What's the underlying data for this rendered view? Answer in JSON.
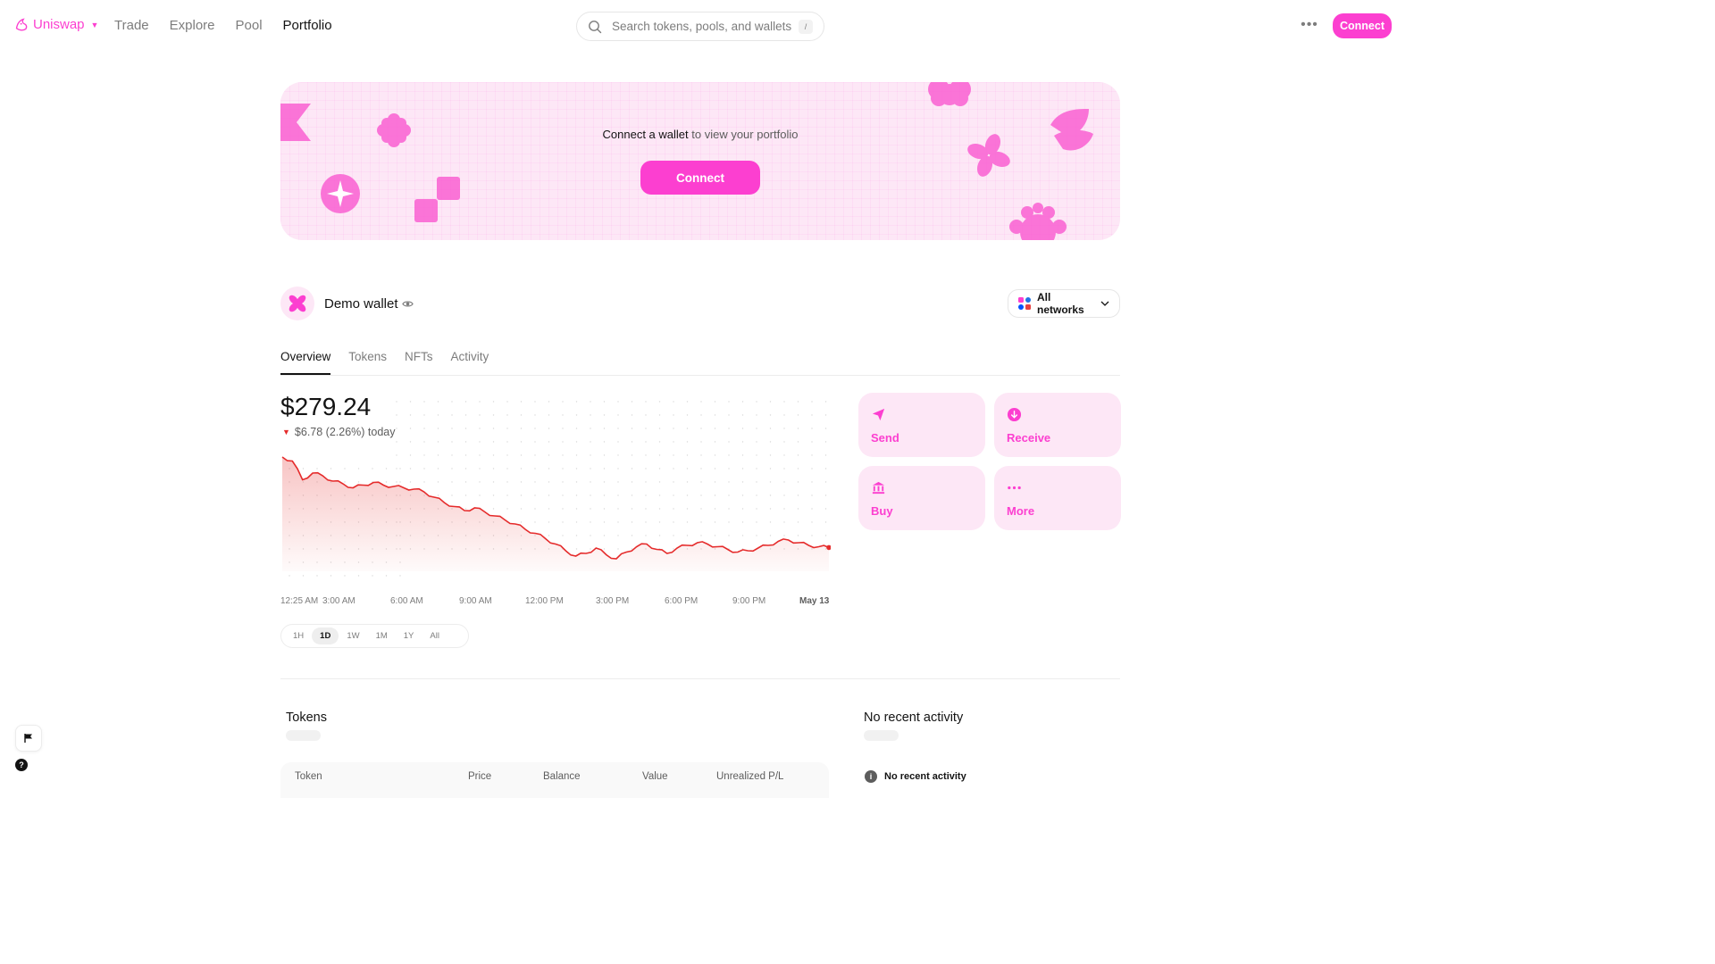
{
  "nav": {
    "brand": "Uniswap",
    "links": [
      "Trade",
      "Explore",
      "Pool",
      "Portfolio"
    ],
    "active_link": "Portfolio",
    "search_placeholder": "Search tokens, pools, and wallets",
    "search_shortcut": "/",
    "connect_label": "Connect"
  },
  "banner": {
    "lead": "Connect a wallet",
    "rest": " to view your portfolio",
    "connect_label": "Connect"
  },
  "wallet": {
    "name": "Demo wallet",
    "network_selector": "All networks"
  },
  "tabs": [
    "Overview",
    "Tokens",
    "NFTs",
    "Activity"
  ],
  "overview": {
    "balance": "$279.24",
    "change_text": "$6.78 (2.26%) today",
    "change_direction": "down",
    "ranges": [
      "1H",
      "1D",
      "1W",
      "1M",
      "1Y",
      "All"
    ],
    "active_range": "1D"
  },
  "chart_data": {
    "type": "line",
    "x_labels": [
      "12:25 AM",
      "3:00 AM",
      "6:00 AM",
      "9:00 AM",
      "12:00 PM",
      "3:00 PM",
      "6:00 PM",
      "9:00 PM",
      "May 13"
    ],
    "series": [
      {
        "values": [
          286.0,
          285.7,
          284.3,
          284.8,
          284.6,
          284.2,
          284.0,
          283.7,
          283.9,
          284.1,
          283.9,
          283.8,
          283.7,
          283.6,
          283.4,
          283.0,
          282.6,
          282.3,
          282.0,
          282.2,
          281.9,
          281.6,
          281.3,
          281.0,
          280.6,
          280.3,
          279.9,
          279.5,
          279.0,
          278.6,
          278.8,
          279.2,
          278.7,
          278.4,
          278.9,
          279.3,
          279.5,
          279.1,
          278.8,
          279.2,
          279.4,
          279.6,
          279.5,
          279.3,
          279.1,
          278.9,
          279.0,
          279.2,
          279.4,
          279.7,
          279.8,
          279.6,
          279.4,
          279.3,
          279.24
        ]
      }
    ],
    "line_color": "#e52b2b",
    "grid": "dotted"
  },
  "actions": [
    {
      "label": "Send",
      "icon": "send-icon"
    },
    {
      "label": "Receive",
      "icon": "receive-icon"
    },
    {
      "label": "Buy",
      "icon": "bank-icon"
    },
    {
      "label": "More",
      "icon": "more-dots-icon"
    }
  ],
  "tokens_section": {
    "title": "Tokens",
    "columns": [
      "Token",
      "Price",
      "Balance",
      "Value",
      "Unrealized P/L"
    ]
  },
  "activity_section": {
    "title": "No recent activity",
    "empty_text": "No recent activity"
  },
  "colors": {
    "brand": "#fc3fd0",
    "brand_soft": "#fde7f6",
    "negative": "#e52b2b"
  }
}
